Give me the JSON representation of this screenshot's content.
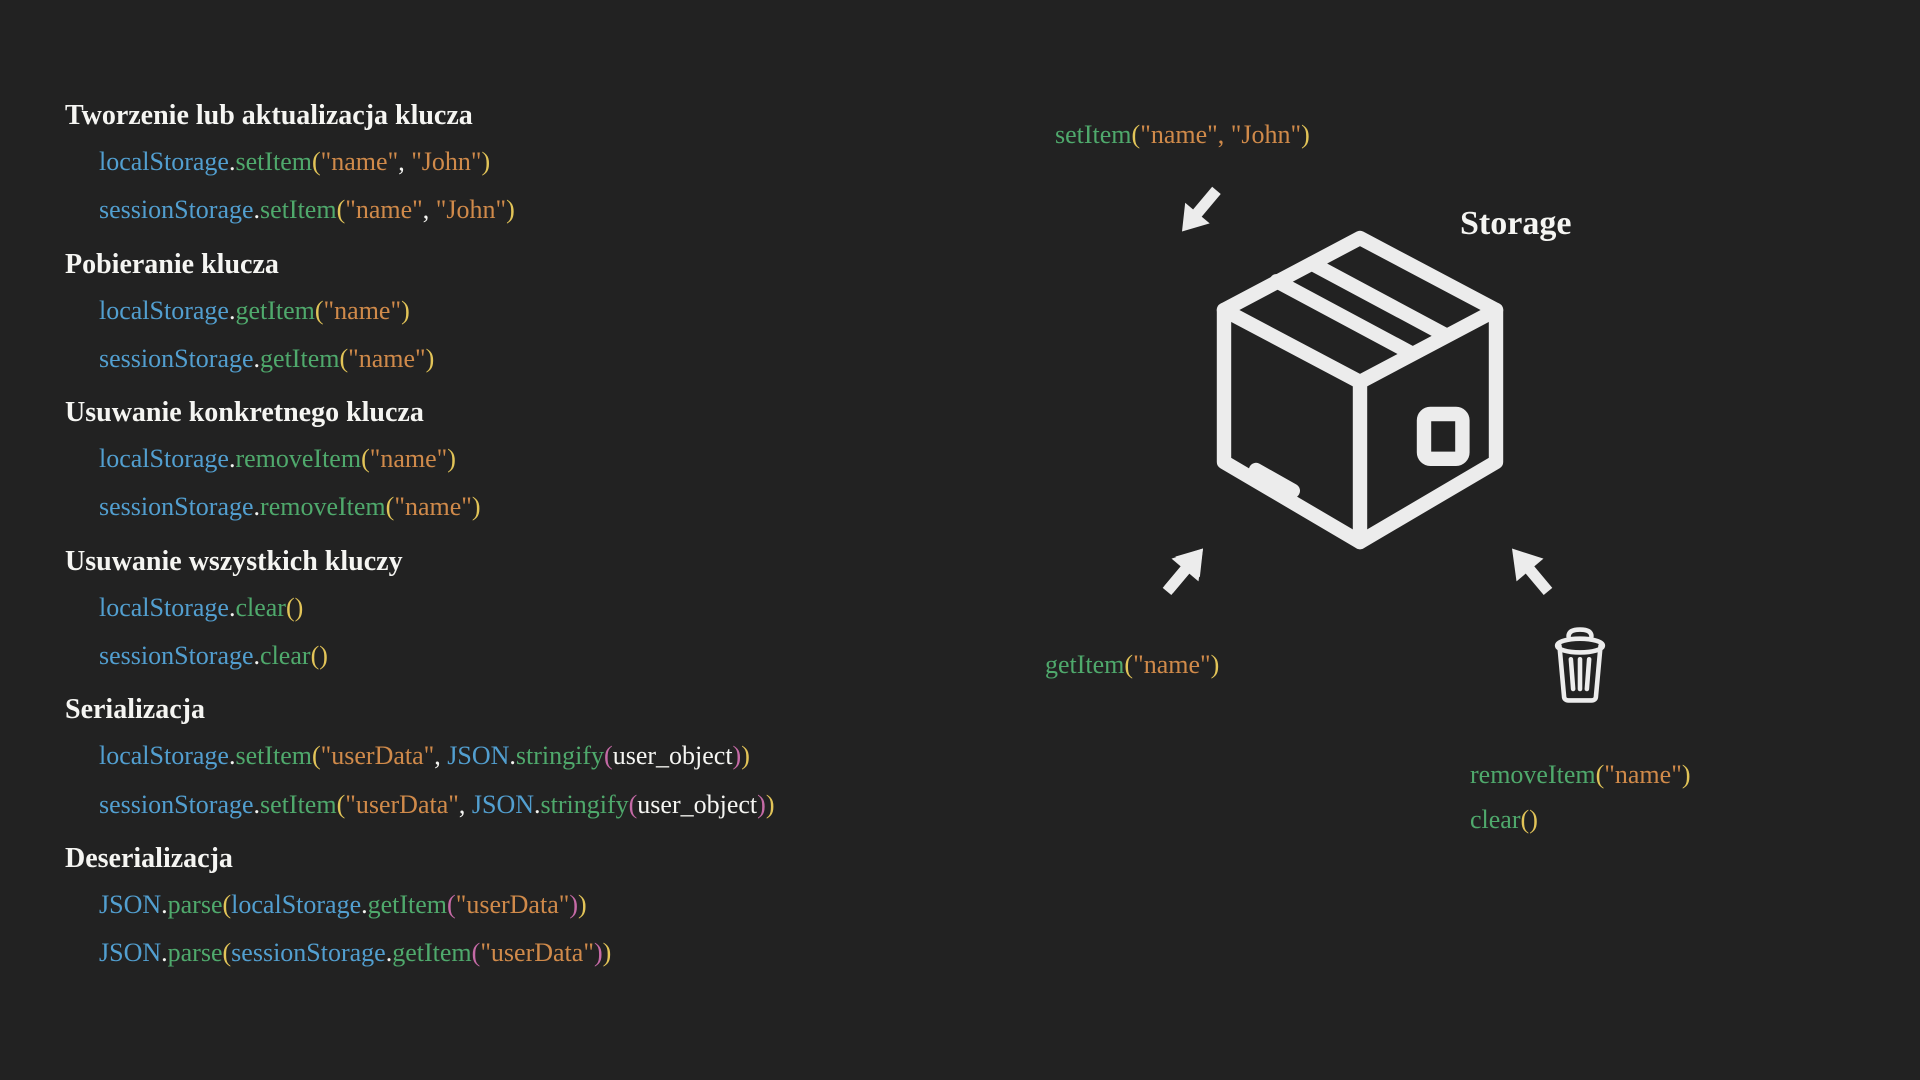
{
  "tokens": {
    "localStorage": "localStorage",
    "sessionStorage": "sessionStorage",
    "JSON": "JSON",
    "dot": ".",
    "comma": ", ",
    "lp": "(",
    "rp": ")",
    "setItem": "setItem",
    "getItem": "getItem",
    "removeItem": "removeItem",
    "clear": "clear",
    "stringify": "stringify",
    "parse": "parse",
    "str_name": "\"name\"",
    "str_john": "\"John\"",
    "str_userData": "\"userData\"",
    "user_object": "user_object"
  },
  "sections": {
    "create": "Tworzenie lub aktualizacja klucza",
    "get": "Pobieranie klucza",
    "remove": "Usuwanie konkretnego klucza",
    "clear": "Usuwanie wszystkich kluczy",
    "serialize": "Serializacja",
    "deserialize": "Deserializacja"
  },
  "diagram": {
    "storage_title": "Storage",
    "setItem": {
      "fn": "setItem",
      "args": "\"name\", \"John\""
    },
    "getItem": {
      "fn": "getItem",
      "arg": "\"name\""
    },
    "removeItem": {
      "fn": "removeItem",
      "arg": "\"name\""
    },
    "clear": {
      "fn": "clear"
    }
  }
}
